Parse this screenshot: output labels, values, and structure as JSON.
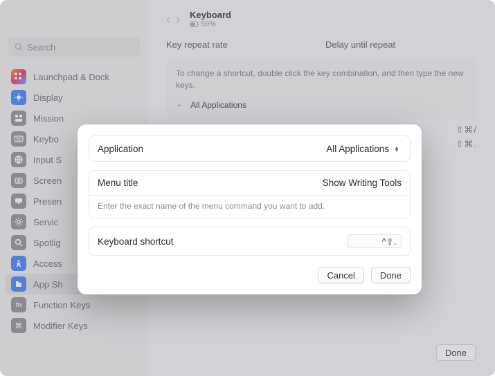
{
  "search": {
    "placeholder": "Search"
  },
  "sidebar": {
    "items": [
      {
        "label": "Launchpad & Dock"
      },
      {
        "label": "Display"
      },
      {
        "label": "Mission"
      },
      {
        "label": "Keybo"
      },
      {
        "label": "Input S"
      },
      {
        "label": "Screen"
      },
      {
        "label": "Presen"
      },
      {
        "label": "Servic"
      },
      {
        "label": "Spotlig"
      },
      {
        "label": "Access"
      },
      {
        "label": "App Sh"
      },
      {
        "label": "Function Keys"
      },
      {
        "label": "Modifier Keys"
      }
    ]
  },
  "header": {
    "title": "Keyboard",
    "battery": "59%"
  },
  "panel": {
    "repeat_label": "Key repeat rate",
    "delay_label": "Delay until repeat",
    "help": "To change a shortcut, double click the key combination, and then type the new keys.",
    "all_apps": "All Applications",
    "shortcuts": [
      "⇧⌘/",
      "⇧⌘."
    ]
  },
  "bottom_done": "Done",
  "modal": {
    "app_label": "Application",
    "app_value": "All Applications",
    "menu_label": "Menu title",
    "menu_value": "Show Writing Tools",
    "menu_help": "Enter the exact name of the menu command you want to add.",
    "ks_label": "Keyboard shortcut",
    "ks_value": "^⇧.",
    "cancel": "Cancel",
    "done": "Done"
  }
}
